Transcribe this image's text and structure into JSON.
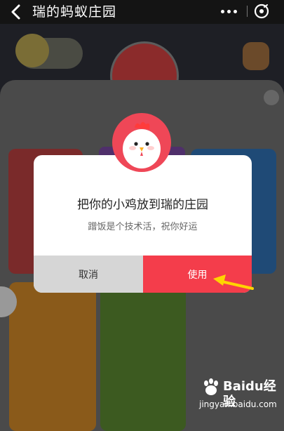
{
  "header": {
    "title": "瑞的蚂蚁庄园"
  },
  "dialog": {
    "title": "把你的小鸡放到瑞的庄园",
    "subtitle": "蹭饭是个技术活，祝你好运",
    "cancel_label": "取消",
    "use_label": "使用"
  },
  "watermark": {
    "brand": "Baidu经验",
    "url": "jingyan.baidu.com"
  },
  "colors": {
    "accent": "#f43d4b",
    "cancel_bg": "#d6d6d6",
    "arrow": "#ffd400"
  }
}
